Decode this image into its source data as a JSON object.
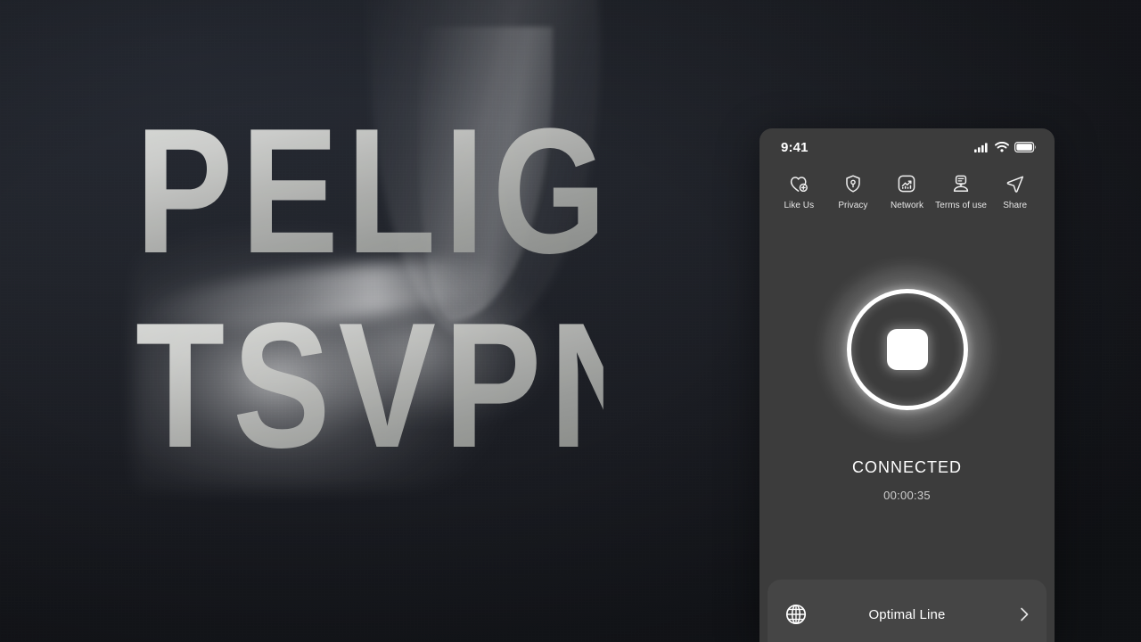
{
  "brand": {
    "line1": "PELIGH",
    "line2": "TSVPN"
  },
  "phone": {
    "status_bar": {
      "time": "9:41",
      "icons": [
        "cellular-signal-icon",
        "wifi-icon",
        "battery-icon"
      ]
    },
    "menu": [
      {
        "label": "Like Us",
        "icon": "heart-plus-icon"
      },
      {
        "label": "Privacy",
        "icon": "shield-keyhole-icon"
      },
      {
        "label": "Network",
        "icon": "chart-square-icon"
      },
      {
        "label": "Terms of use",
        "icon": "terms-document-icon"
      },
      {
        "label": "Share",
        "icon": "paper-plane-icon"
      }
    ],
    "power": {
      "icon": "stop-square-icon",
      "state": "connected"
    },
    "status": {
      "label": "CONNECTED",
      "timer": "00:00:35"
    },
    "line_card": {
      "icon": "globe-icon",
      "label": "Optimal Line",
      "chevron": "chevron-right-icon"
    }
  },
  "colors": {
    "panel_bg": "#3c3c3c",
    "card_bg": "#454545",
    "accent": "#ffffff",
    "page_bg": "#1a1c22",
    "brand_text": "#cfd0ce"
  }
}
